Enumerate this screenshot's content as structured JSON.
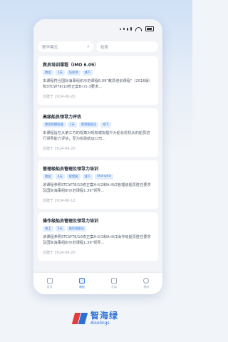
{
  "filters": {
    "type_select": "教学模式",
    "search_placeholder": "检索"
  },
  "courses": [
    {
      "title": "救员培训课程（IMO 6.09）",
      "tags": [
        "教室",
        "1天",
        "培训师",
        "线下"
      ],
      "desc": "本课程符合国际海事组织示范课程6.09\"教员培训课程\"（2016版）和STCW78/10修正案B-I/1-3要求...",
      "date": "创建于 2024-06-20"
    },
    {
      "title": "高级船员领导力评估",
      "tags": [
        "教室和模拟器",
        "1天",
        "管理级船员",
        "线下"
      ],
      "desc": "本课程旨在从第三方的视角对现有或拟提升为船长轮机长的船员进行领导能力评估，至为协助航运公司...",
      "date": "创建于 2024-06-20"
    },
    {
      "title": "管理级船员管理及领导力培训",
      "tags": [
        "教室",
        "4天",
        "管理级",
        "线下",
        "Shanghai"
      ],
      "desc": "该课程参照STCW78/10修正案A-II/2和A-III/2管理级船员胜任要求及国际海事组织示范课程1.39\"领导...",
      "date": "创建于 2024-06-12"
    },
    {
      "title": "操作级船员管理及领导力培训",
      "tags": [
        "线上",
        "5天",
        "操作级船员"
      ],
      "desc": "该课程参照STCW78/10修正案A-II/1和A-III/1操作级船员胜任要求及国际海事组织示范课程1.39\"领导...",
      "date": "创建于 2024-06-20"
    }
  ],
  "tabbar": {
    "tabs": [
      {
        "label": "首页",
        "icon": "home-icon"
      },
      {
        "label": "课程",
        "icon": "course-icon"
      },
      {
        "label": "活动",
        "icon": "calendar-icon"
      },
      {
        "label": "我的",
        "icon": "user-icon"
      }
    ],
    "active_index": 1
  },
  "brand": {
    "name_cn": "智海绿",
    "name_en": "Aisolings"
  }
}
